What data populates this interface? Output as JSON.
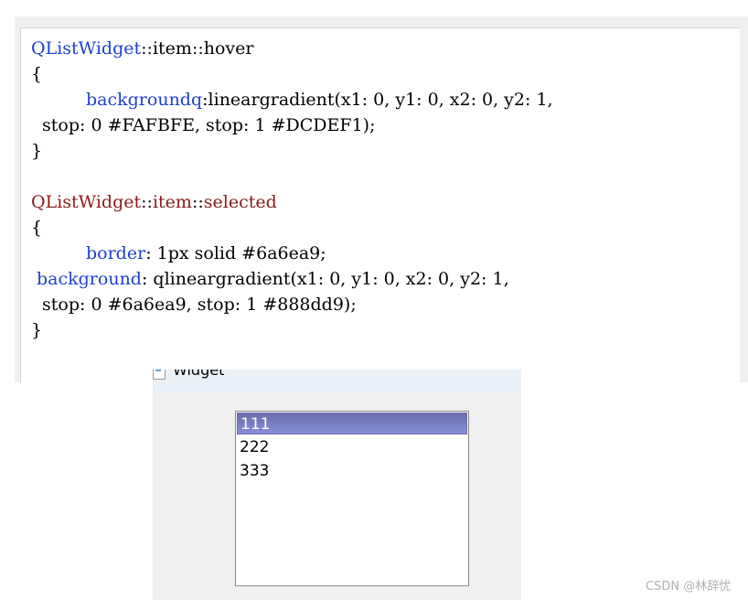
{
  "code": {
    "block1": {
      "selector_class": "QListWidget",
      "selector_sep1": "::",
      "selector_sub": "item",
      "selector_sep2": "::",
      "selector_state": "hover",
      "open": "{",
      "prop": "backgroundq",
      "value": ":lineargradient(x1: 0, y1: 0, x2: 0, y2: 1,",
      "value2": " stop: 0 #FAFBFE, stop: 1 #DCDEF1);",
      "close": "}"
    },
    "block2": {
      "selector_class": "QListWidget",
      "selector_sep1": "::",
      "selector_sub": "item",
      "selector_sep2": "::",
      "selector_state": "selected",
      "open": "{",
      "prop1": "border",
      "value1": ": 1px solid #6a6ea9;",
      "prop2": "background",
      "value2": ": qlineargradient(x1: 0, y1: 0, x2: 0, y2: 1,",
      "value3": " stop: 0 #6a6ea9, stop: 1 #888dd9);",
      "close": "}"
    }
  },
  "widget": {
    "title": "Widget",
    "items": [
      "111",
      "222",
      "333"
    ],
    "selected_index": 0
  },
  "watermark": "CSDN @林辞忧",
  "colors": {
    "keyword_blue": "#1f3fd1",
    "keyword_red": "#8b1a1a",
    "selected_border": "#6a6ea9",
    "selected_grad_top": "#6a6ea9",
    "selected_grad_bottom": "#888dd9"
  },
  "icons": {
    "window_icon": "window-icon"
  }
}
